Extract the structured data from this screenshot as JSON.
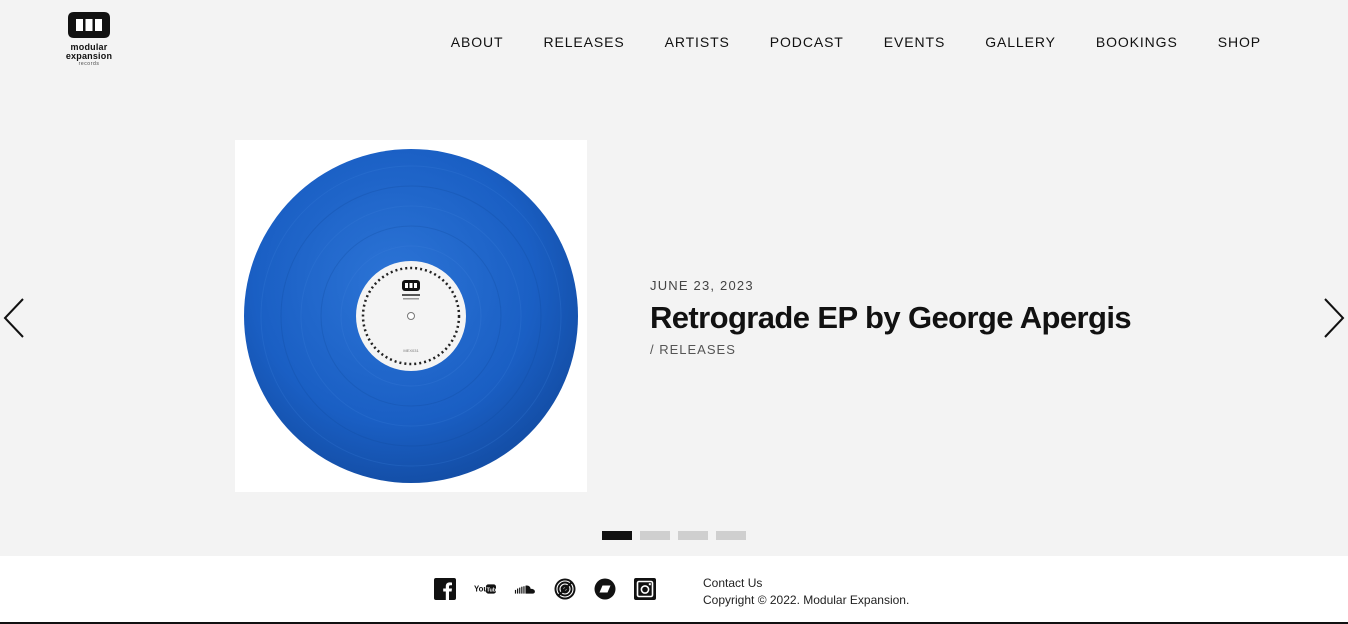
{
  "brand": {
    "line1": "modular",
    "line2": "expansion",
    "line3": "records"
  },
  "nav": [
    {
      "label": "ABOUT"
    },
    {
      "label": "RELEASES"
    },
    {
      "label": "ARTISTS"
    },
    {
      "label": "PODCAST"
    },
    {
      "label": "EVENTS"
    },
    {
      "label": "GALLERY"
    },
    {
      "label": "BOOKINGS"
    },
    {
      "label": "SHOP"
    }
  ],
  "slide": {
    "date": "JUNE 23, 2023",
    "title": "Retrograde EP by George Apergis",
    "category": "/ RELEASES",
    "vinyl_color": "#1a5fc4",
    "label_text": "MEX031"
  },
  "slider": {
    "total": 4,
    "active": 1
  },
  "footer": {
    "contact": "Contact Us",
    "copyright": "Copyright © 2022. Modular Expansion.",
    "socials": [
      {
        "icon": "facebook-icon"
      },
      {
        "icon": "youtube-icon"
      },
      {
        "icon": "soundcloud-icon"
      },
      {
        "icon": "discogs-icon"
      },
      {
        "icon": "bandcamp-icon"
      },
      {
        "icon": "instagram-icon"
      }
    ]
  }
}
